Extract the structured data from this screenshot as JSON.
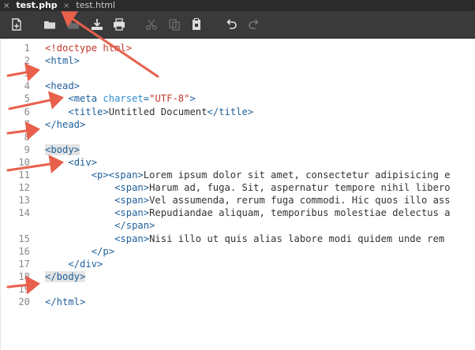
{
  "tabs": [
    {
      "label": "test.php",
      "active": true
    },
    {
      "label": "test.html",
      "active": false
    }
  ],
  "tab_close_glyph": "×",
  "toolbar": {
    "icons": [
      "new-file-icon",
      "open-folder-icon",
      "save-icon",
      "download-icon",
      "print-icon",
      "cut-icon",
      "copy-icon",
      "paste-icon",
      "undo-icon",
      "redo-icon"
    ]
  },
  "editor": {
    "lines": [
      {
        "n": "1",
        "indent": "",
        "parts": [
          {
            "t": "<!doctype html>",
            "c": "doc"
          }
        ]
      },
      {
        "n": "2",
        "indent": "",
        "parts": [
          {
            "t": "<html>",
            "c": "tag"
          }
        ]
      },
      {
        "n": "3",
        "indent": "",
        "parts": []
      },
      {
        "n": "4",
        "indent": "",
        "parts": [
          {
            "t": "<head>",
            "c": "tag"
          }
        ]
      },
      {
        "n": "5",
        "indent": "    ",
        "parts": [
          {
            "t": "<meta ",
            "c": "tag"
          },
          {
            "t": "charset",
            "c": "attr"
          },
          {
            "t": "=",
            "c": "tag"
          },
          {
            "t": "\"UTF-8\"",
            "c": "str"
          },
          {
            "t": ">",
            "c": "tag"
          }
        ]
      },
      {
        "n": "6",
        "indent": "    ",
        "parts": [
          {
            "t": "<title>",
            "c": "tag"
          },
          {
            "t": "Untitled Document",
            "c": "txt"
          },
          {
            "t": "</title>",
            "c": "tag"
          }
        ]
      },
      {
        "n": "7",
        "indent": "",
        "parts": [
          {
            "t": "</head>",
            "c": "tag"
          }
        ]
      },
      {
        "n": "8",
        "indent": "",
        "parts": []
      },
      {
        "n": "9",
        "indent": "",
        "parts": [
          {
            "t": "<body>",
            "c": "tag hl"
          }
        ]
      },
      {
        "n": "10",
        "indent": "    ",
        "parts": [
          {
            "t": "<div>",
            "c": "tag"
          }
        ]
      },
      {
        "n": "11",
        "indent": "        ",
        "parts": [
          {
            "t": "<p>",
            "c": "tag"
          },
          {
            "t": "<span>",
            "c": "tag"
          },
          {
            "t": "Lorem ipsum dolor sit amet, consectetur adipisicing e",
            "c": "txt"
          }
        ]
      },
      {
        "n": "12",
        "indent": "            ",
        "parts": [
          {
            "t": "<span>",
            "c": "tag"
          },
          {
            "t": "Harum ad, fuga. Sit, aspernatur tempore nihil libero",
            "c": "txt"
          }
        ]
      },
      {
        "n": "13",
        "indent": "            ",
        "parts": [
          {
            "t": "<span>",
            "c": "tag"
          },
          {
            "t": "Vel assumenda, rerum fuga commodi. Hic quos illo ass",
            "c": "txt"
          }
        ]
      },
      {
        "n": "14",
        "indent": "            ",
        "parts": [
          {
            "t": "<span>",
            "c": "tag"
          },
          {
            "t": "Repudiandae aliquam, temporibus molestiae delectus a",
            "c": "txt"
          }
        ]
      },
      {
        "n": "",
        "indent": "            ",
        "parts": [
          {
            "t": "</span>",
            "c": "tag"
          }
        ]
      },
      {
        "n": "15",
        "indent": "            ",
        "parts": [
          {
            "t": "<span>",
            "c": "tag"
          },
          {
            "t": "Nisi illo ut quis alias labore modi quidem unde rem",
            "c": "txt"
          }
        ]
      },
      {
        "n": "16",
        "indent": "        ",
        "parts": [
          {
            "t": "</p>",
            "c": "tag"
          }
        ]
      },
      {
        "n": "17",
        "indent": "    ",
        "parts": [
          {
            "t": "</div>",
            "c": "tag"
          }
        ]
      },
      {
        "n": "18",
        "indent": "",
        "parts": [
          {
            "t": "</body>",
            "c": "tag hl"
          }
        ]
      },
      {
        "n": "19",
        "indent": "",
        "parts": []
      },
      {
        "n": "20",
        "indent": "",
        "parts": [
          {
            "t": "</html>",
            "c": "tag"
          }
        ]
      }
    ]
  },
  "colors": {
    "tag": "#1f5f9a",
    "attribute": "#2e8fd0",
    "string": "#c0392b",
    "annotation_arrow": "#e8604c",
    "tabbar": "#2b2b2b",
    "toolbar": "#3a3a3a"
  }
}
